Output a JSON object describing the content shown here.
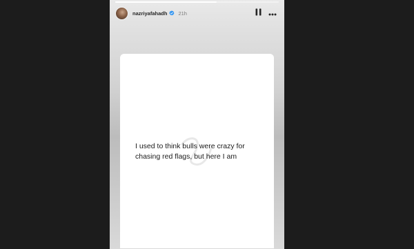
{
  "story": {
    "progress": 0.62,
    "username": "nazriyafahadh",
    "timestamp": "21h",
    "icons": {
      "avatar": "profile-avatar",
      "verified": "verified-badge-icon",
      "pause": "pause-icon",
      "more": "more-options-icon"
    }
  },
  "card": {
    "text": "I used to think bulls were crazy for chasing red flags, but here I am"
  },
  "colors": {
    "background": "#1c1c1c",
    "card": "#ffffff",
    "username": "#262626",
    "timestamp": "#7a7a7a",
    "verified": "#3897f0"
  }
}
